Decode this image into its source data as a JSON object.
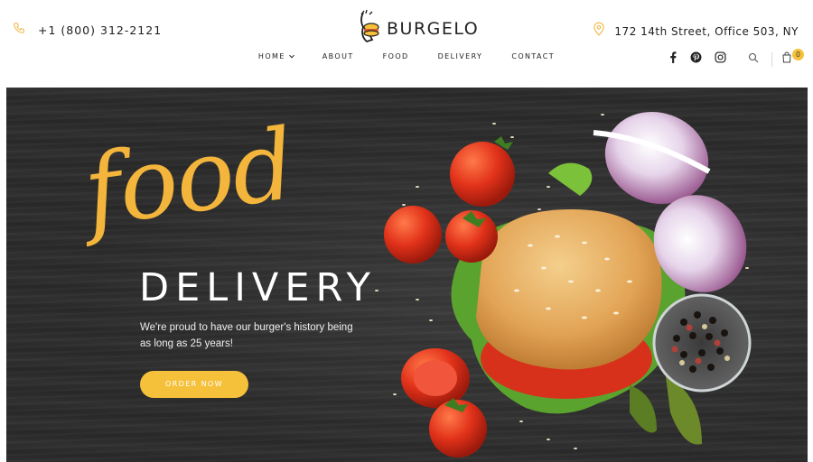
{
  "header": {
    "phone": "+1 (800) 312-2121",
    "logo_text": "BURGELO",
    "address": "172 14th Street, Office 503, NY",
    "cart_count": "0"
  },
  "nav": {
    "items": [
      {
        "label": "HOME",
        "has_dropdown": true
      },
      {
        "label": "ABOUT"
      },
      {
        "label": "FOOD"
      },
      {
        "label": "DELIVERY"
      },
      {
        "label": "CONTACT"
      }
    ]
  },
  "social": {
    "icons": [
      "facebook-icon",
      "pinterest-icon",
      "instagram-icon"
    ]
  },
  "tools": {
    "icons": [
      "search-icon",
      "shopping-bag-icon"
    ]
  },
  "hero": {
    "script_title": "food",
    "title": "DELIVERY",
    "tagline": "We're proud to have our burger's history being as long as 25 years!",
    "button_label": "ORDER NOW"
  },
  "colors": {
    "accent": "#f5c13a",
    "hero_background": "#2b2b2b",
    "text_dark": "#1d1d1d"
  }
}
